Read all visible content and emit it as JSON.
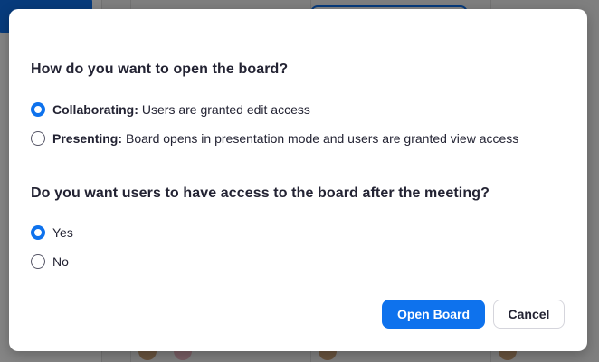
{
  "dialog": {
    "question_open": "How do you want to open the board?",
    "open_options": [
      {
        "label": "Collaborating:",
        "description": "Users are granted edit access",
        "selected": true
      },
      {
        "label": "Presenting:",
        "description": "Board opens in presentation mode and users are granted view access",
        "selected": false
      }
    ],
    "question_access": "Do you want users to have access to the board after the meeting?",
    "access_options": [
      {
        "label": "Yes",
        "selected": true
      },
      {
        "label": "No",
        "selected": false
      }
    ],
    "primary_button": "Open Board",
    "secondary_button": "Cancel"
  },
  "colors": {
    "accent": "#0e72ed",
    "text": "#232333",
    "overlay": "rgba(0,0,0,0.48)"
  }
}
